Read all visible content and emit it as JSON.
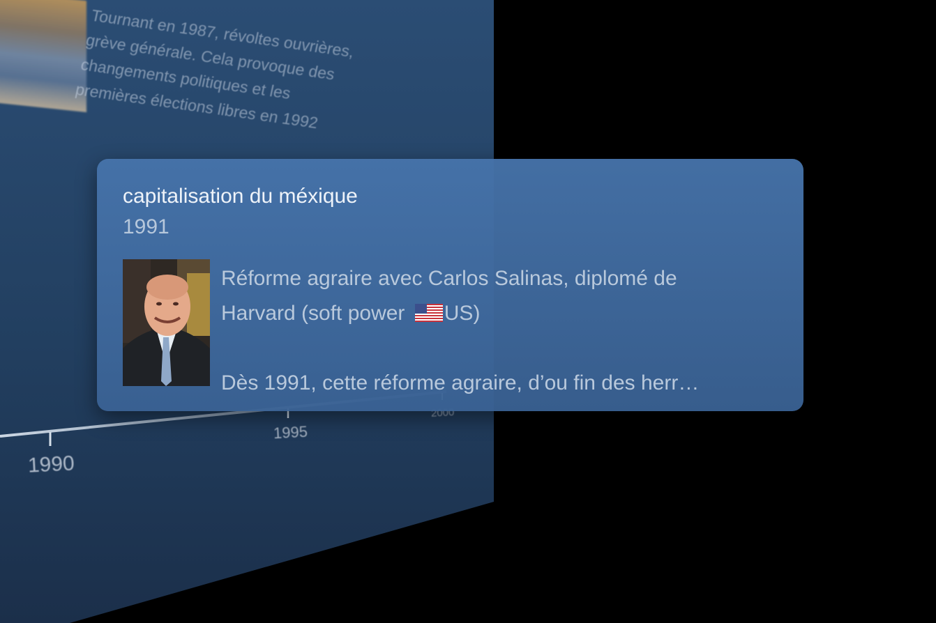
{
  "background_panel": {
    "description_text": "Tournant en 1987, révoltes ouvrières,\ngrève générale. Cela provoque des\nchangements politiques et les\npremières élections libres en 1992",
    "ticks": [
      "1990",
      "1995",
      "2000"
    ]
  },
  "event_card": {
    "title": "capitalisation du méxique",
    "year": "1991",
    "description_line1": "Réforme agraire avec Carlos Salinas, diplomé de",
    "description_line2_prefix": "Harvard (soft power ",
    "description_line2_suffix": "US)",
    "description_line3": "Dès 1991, cette réforme agraire, d’ou fin des herr…",
    "flag_icon": "us-flag-icon"
  },
  "colors": {
    "background": "#000000",
    "panel": "#26466b",
    "card": "#4673aa",
    "card_title": "#eef3f9",
    "card_text": "#b9c9dc"
  }
}
